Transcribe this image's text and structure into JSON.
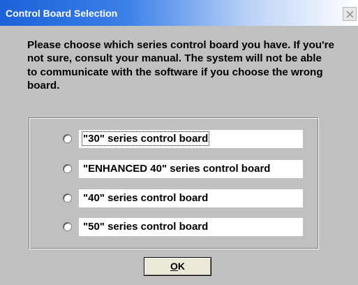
{
  "window": {
    "title": "Control Board Selection",
    "close_icon": "close-icon"
  },
  "prompt": "Please choose which series control board you have.  If you're not sure, consult your manual.  The system will not be able to communicate with the software if you choose the wrong board.",
  "options": [
    {
      "label": "\"30\" series control board",
      "selected": false,
      "focused": true
    },
    {
      "label": "\"ENHANCED 40\" series control board",
      "selected": false,
      "focused": false
    },
    {
      "label": "\"40\" series control board",
      "selected": false,
      "focused": false
    },
    {
      "label": "\"50\" series control board",
      "selected": false,
      "focused": false
    }
  ],
  "ok_button": {
    "mnemonic": "O",
    "rest": "K"
  },
  "colors": {
    "title_blue": "#1c61d8",
    "dialog_gray": "#c0c0c0"
  }
}
